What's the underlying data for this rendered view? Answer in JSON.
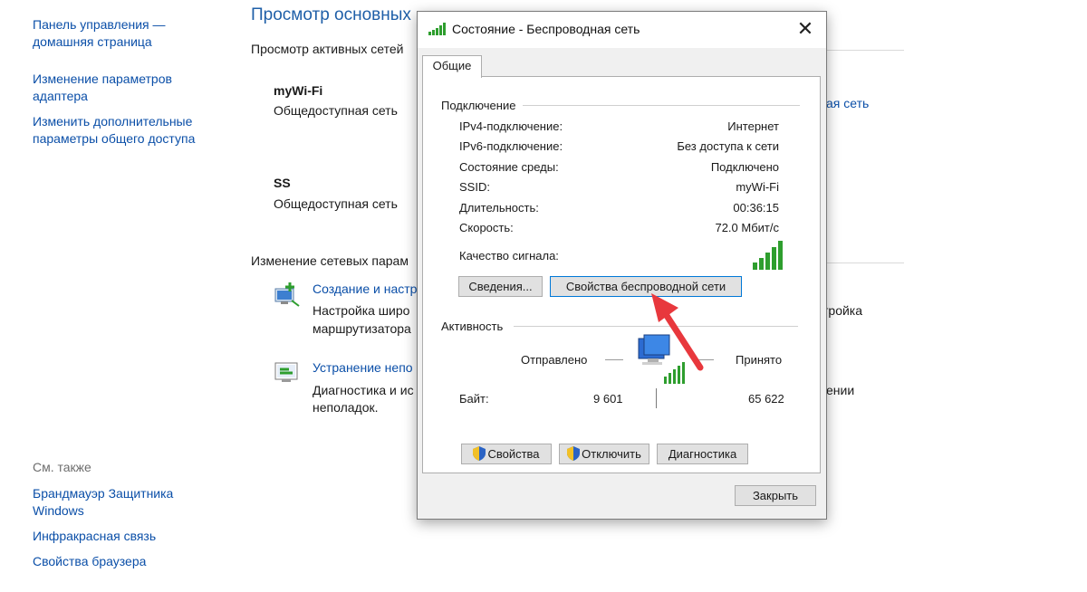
{
  "sidebar": {
    "home_link": "Панель управления — домашняя страница",
    "adapter_link": "Изменение параметров адаптера",
    "sharing_link": "Изменить дополнительные параметры общего доступа",
    "see_also": "См. также",
    "firewall_link": "Брандмауэр Защитника Windows",
    "infrared_link": "Инфракрасная связь",
    "browser_link": "Свойства браузера"
  },
  "main": {
    "title": "Просмотр основных",
    "active_networks": "Просмотр активных сетей",
    "networks": [
      {
        "name": "myWi-Fi",
        "type": "Общедоступная сеть"
      },
      {
        "name": "SS",
        "type": "Общедоступная сеть"
      }
    ],
    "partial_link_right": "ая сеть",
    "change_settings": "Изменение сетевых парам",
    "tasks": [
      {
        "link": "Создание и настр",
        "desc_line1": "Настройка широ",
        "desc_line2": "маршрутизатора",
        "right_text": "тройка"
      },
      {
        "link": "Устранение непо",
        "desc_line1": "Диагностика и ис",
        "desc_line2": "неполадок.",
        "right_text": "ении"
      }
    ]
  },
  "dialog": {
    "title": "Состояние - Беспроводная сеть",
    "tab": "Общие",
    "connection_group": "Подключение",
    "rows": [
      {
        "label": "IPv4-подключение:",
        "value": "Интернет"
      },
      {
        "label": "IPv6-подключение:",
        "value": "Без доступа к сети"
      },
      {
        "label": "Состояние среды:",
        "value": "Подключено"
      },
      {
        "label": "SSID:",
        "value": "myWi-Fi"
      },
      {
        "label": "Длительность:",
        "value": "00:36:15"
      },
      {
        "label": "Скорость:",
        "value": "72.0 Мбит/с"
      }
    ],
    "signal_label": "Качество сигнала:",
    "details_button": "Сведения...",
    "wireless_props_button": "Свойства беспроводной сети",
    "activity_group": "Активность",
    "sent_label": "Отправлено",
    "received_label": "Принято",
    "bytes_label": "Байт:",
    "bytes_sent": "9 601",
    "bytes_received": "65 622",
    "properties_button": "Свойства",
    "disconnect_button": "Отключить",
    "diagnostics_button": "Диагностика",
    "close_button": "Закрыть"
  },
  "colors": {
    "link_blue": "#0b4fa8",
    "signal_green": "#2e9e2e",
    "arrow_red": "#e8383d"
  }
}
